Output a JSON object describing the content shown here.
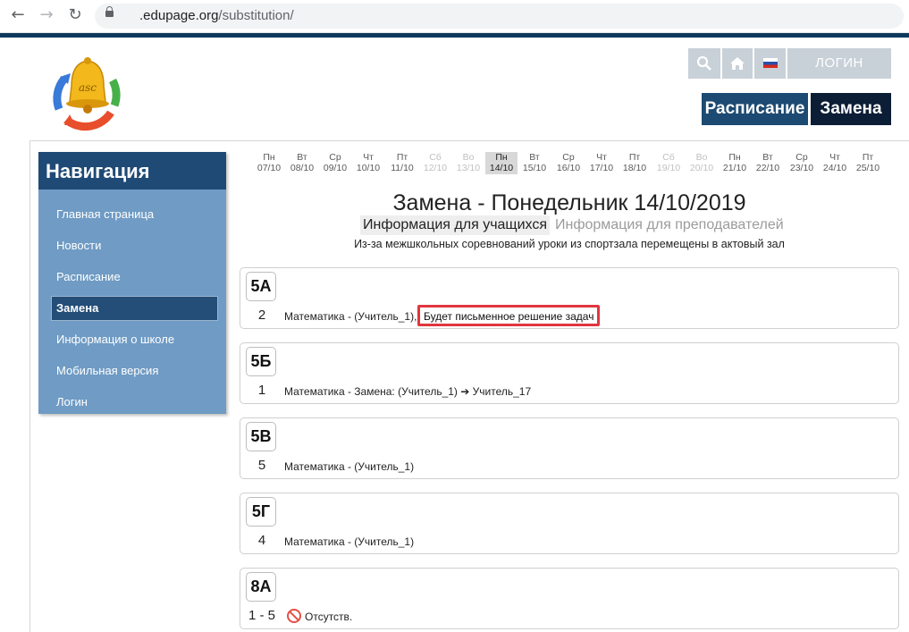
{
  "browser": {
    "url_host": ".edupage.org",
    "url_path": "/substitution/"
  },
  "header": {
    "login_label": "ЛОГИН",
    "menu": [
      {
        "label": "Расписание"
      },
      {
        "label": "Замена"
      }
    ],
    "accent_color": "#1c4a72"
  },
  "sidebar": {
    "title": "Навигация",
    "items": [
      {
        "label": "Главная страница",
        "active": false
      },
      {
        "label": "Новости",
        "active": false
      },
      {
        "label": "Расписание",
        "active": false
      },
      {
        "label": "Замена",
        "active": true
      },
      {
        "label": "Информация о школе",
        "active": false
      },
      {
        "label": "Мобильная версия",
        "active": false
      },
      {
        "label": "Логин",
        "active": false
      }
    ]
  },
  "days": [
    {
      "dow": "Пн",
      "date": "07/10"
    },
    {
      "dow": "Вт",
      "date": "08/10"
    },
    {
      "dow": "Ср",
      "date": "09/10"
    },
    {
      "dow": "Чт",
      "date": "10/10"
    },
    {
      "dow": "Пт",
      "date": "11/10"
    },
    {
      "dow": "Сб",
      "date": "12/10",
      "weekend": true
    },
    {
      "dow": "Во",
      "date": "13/10",
      "weekend": true
    },
    {
      "dow": "Пн",
      "date": "14/10",
      "active": true
    },
    {
      "dow": "Вт",
      "date": "15/10"
    },
    {
      "dow": "Ср",
      "date": "16/10"
    },
    {
      "dow": "Чт",
      "date": "17/10"
    },
    {
      "dow": "Пт",
      "date": "18/10"
    },
    {
      "dow": "Сб",
      "date": "19/10",
      "weekend": true
    },
    {
      "dow": "Во",
      "date": "20/10",
      "weekend": true
    },
    {
      "dow": "Пн",
      "date": "21/10"
    },
    {
      "dow": "Вт",
      "date": "22/10"
    },
    {
      "dow": "Ср",
      "date": "23/10"
    },
    {
      "dow": "Чт",
      "date": "24/10"
    },
    {
      "dow": "Пт",
      "date": "25/10"
    }
  ],
  "main": {
    "title": "Замена - Понедельник 14/10/2019",
    "tab_students": "Информация для учащихся",
    "tab_teachers": "Информация для преподавателей",
    "notice": "Из-за межшкольных соревнований уроки  из спортзала перемещены в актовый зал"
  },
  "classes": [
    {
      "name": "5А",
      "lesson": "2",
      "text": "Математика - (Учитель_1),",
      "note": "Будет письменное решение задач"
    },
    {
      "name": "5Б",
      "lesson": "1",
      "text": "Математика - Замена: (Учитель_1) ➔ Учитель_17"
    },
    {
      "name": "5В",
      "lesson": "5",
      "text": "Математика - (Учитель_1)"
    },
    {
      "name": "5Г",
      "lesson": "4",
      "text": "Математика - (Учитель_1)"
    },
    {
      "name": "8А",
      "lesson": "1 - 5",
      "absent": "Отсутств."
    }
  ]
}
